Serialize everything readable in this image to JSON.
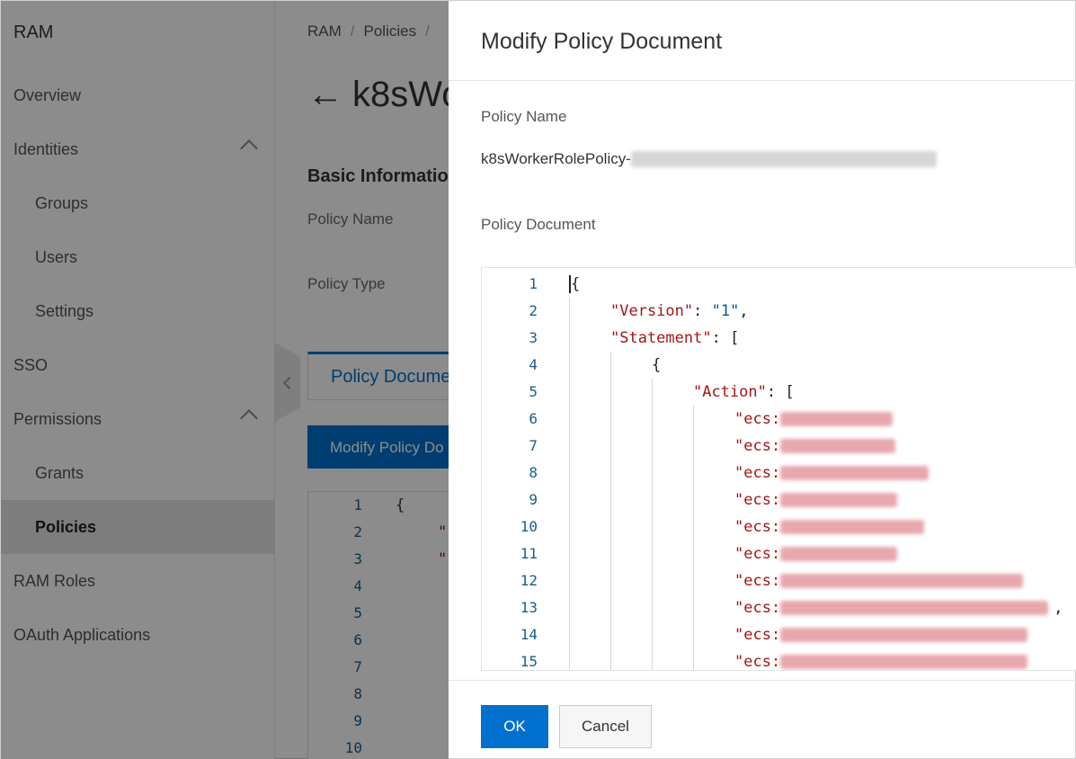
{
  "sidebar": {
    "title": "RAM",
    "items": [
      {
        "label": "Overview"
      },
      {
        "label": "Identities"
      },
      {
        "label": "Groups"
      },
      {
        "label": "Users"
      },
      {
        "label": "Settings"
      },
      {
        "label": "SSO"
      },
      {
        "label": "Permissions"
      },
      {
        "label": "Grants"
      },
      {
        "label": "Policies"
      },
      {
        "label": "RAM Roles"
      },
      {
        "label": "OAuth Applications"
      }
    ]
  },
  "main": {
    "breadcrumb": [
      "RAM",
      "Policies"
    ],
    "title": "k8sWo",
    "basic_info": "Basic Informatio",
    "policy_name_label": "Policy Name",
    "policy_type_label": "Policy Type",
    "tab_label": "Policy Docume",
    "modify_button": "Modify Policy Do",
    "editor_line_numbers": [
      "1",
      "2",
      "3",
      "4",
      "5",
      "6",
      "7",
      "8",
      "9",
      "10"
    ],
    "editor_first_line": "{"
  },
  "drawer": {
    "title": "Modify Policy Document",
    "policy_name_label": "Policy Name",
    "policy_name_value": "k8sWorkerRolePolicy-",
    "policy_document_label": "Policy Document",
    "line_numbers": [
      "1",
      "2",
      "3",
      "4",
      "5",
      "6",
      "7",
      "8",
      "9",
      "10",
      "11",
      "12",
      "13",
      "14",
      "15"
    ],
    "code": {
      "open_brace": "{",
      "version_key": "\"Version\"",
      "version_value": "\"1\"",
      "statement_key": "\"Statement\"",
      "statement_open": "[",
      "inner_open": "{",
      "action_key": "\"Action\"",
      "action_open": "[",
      "action_prefix": "\"ecs:"
    },
    "ok_button": "OK",
    "cancel_button": "Cancel"
  }
}
